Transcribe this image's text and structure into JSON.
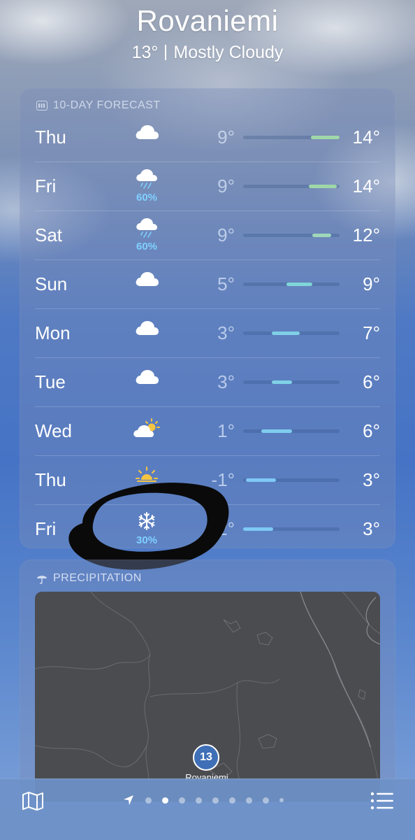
{
  "header": {
    "city": "Rovaniemi",
    "temperature": "13°",
    "condition": "Mostly Cloudy"
  },
  "forecast": {
    "title": "10-DAY FORECAST",
    "days": [
      {
        "day": "Thu",
        "icon": "cloud-icon",
        "precip": "",
        "low": "9°",
        "high": "14°",
        "bar_start": 0.7,
        "bar_end": 1.0,
        "bar_color": "#9fd8a8"
      },
      {
        "day": "Fri",
        "icon": "cloud-rain-icon",
        "precip": "60%",
        "low": "9°",
        "high": "14°",
        "bar_start": 0.68,
        "bar_end": 0.97,
        "bar_color": "#9fd8a8"
      },
      {
        "day": "Sat",
        "icon": "cloud-rain-icon",
        "precip": "60%",
        "low": "9°",
        "high": "12°",
        "bar_start": 0.72,
        "bar_end": 0.91,
        "bar_color": "#9fd8b8"
      },
      {
        "day": "Sun",
        "icon": "cloud-icon",
        "precip": "",
        "low": "5°",
        "high": "9°",
        "bar_start": 0.45,
        "bar_end": 0.72,
        "bar_color": "#7fd6d8"
      },
      {
        "day": "Mon",
        "icon": "cloud-icon",
        "precip": "",
        "low": "3°",
        "high": "7°",
        "bar_start": 0.3,
        "bar_end": 0.59,
        "bar_color": "#7fd0e6"
      },
      {
        "day": "Tue",
        "icon": "cloud-icon",
        "precip": "",
        "low": "3°",
        "high": "6°",
        "bar_start": 0.3,
        "bar_end": 0.51,
        "bar_color": "#7fd0e6"
      },
      {
        "day": "Wed",
        "icon": "cloud-sun-icon",
        "precip": "",
        "low": "1°",
        "high": "6°",
        "bar_start": 0.19,
        "bar_end": 0.51,
        "bar_color": "#7fcdef"
      },
      {
        "day": "Thu",
        "icon": "sun-icon",
        "precip": "",
        "low": "-1°",
        "high": "3°",
        "bar_start": 0.03,
        "bar_end": 0.34,
        "bar_color": "#7fc8f5"
      },
      {
        "day": "Fri",
        "icon": "snowflake-icon",
        "precip": "30%",
        "low": "-2°",
        "high": "3°",
        "bar_start": 0.0,
        "bar_end": 0.31,
        "bar_color": "#7fc8f5"
      }
    ]
  },
  "precipitation": {
    "title": "PRECIPITATION",
    "pin_temp": "13",
    "pin_city": "Rovaniemi"
  },
  "tabbar": {
    "map_icon": "map-icon",
    "list_icon": "list-icon",
    "pages": 9,
    "active_page": 1
  }
}
